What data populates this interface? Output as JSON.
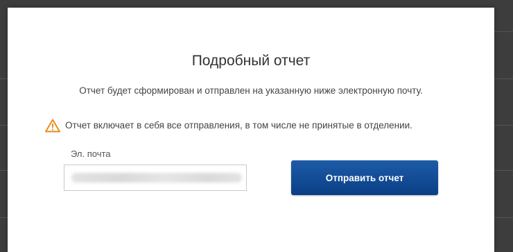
{
  "dialog": {
    "title": "Подробный отчет",
    "description": "Отчет будет сформирован и отправлен на указанную ниже электронную почту.",
    "warning": {
      "icon": "warning-triangle-icon",
      "text": "Отчет включает в себя все отправления, в том числе не принятые в отделении."
    },
    "email": {
      "label": "Эл. почта",
      "value": ""
    },
    "submit_label": "Отправить отчет"
  },
  "colors": {
    "button_top": "#1d5ba7",
    "button_bottom": "#0a3f86",
    "warning_icon": "#e98a1c",
    "backdrop": "#3d3d3d"
  }
}
